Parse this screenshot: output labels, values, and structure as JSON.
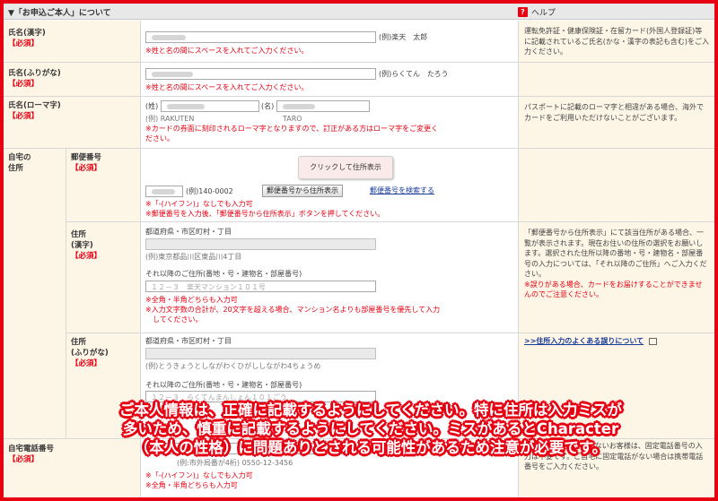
{
  "section": {
    "title": "▼「お申込ご本人」について",
    "help_label": "ヘルプ",
    "help_icon": "question-icon"
  },
  "required": "【必須】",
  "name_kanji": {
    "label": "氏名(漢字)",
    "example": "(例)楽天　太郎",
    "note": "※姓と名の間にスペースを入れてご入力ください。",
    "help": "運転免許証・健康保険証・在留カード(外国人登録証)等に記載されているご氏名(かな・漢字の表記も含む)をご入力ください。"
  },
  "name_kana": {
    "label": "氏名(ふりがな)",
    "example": "(例)らくてん　たろう",
    "note": "※姓と名の間にスペースを入れてご入力ください。"
  },
  "name_roman": {
    "label": "氏名(ローマ字)",
    "sei_label": "(姓)",
    "mei_label": "(名)",
    "example_sei": "(例) RAKUTEN",
    "example_mei": "TARO",
    "note_line1": "※カードの券面に刻印されるローマ字となりますので、訂正がある方はローマ字をご変更く",
    "note_line2": "ださい。",
    "help": "パスポートに記載のローマ字と相違がある場合、海外でカードをご利用いただけないことがございます。"
  },
  "address": {
    "label_line1": "自宅の",
    "label_line2": "住所",
    "postal": {
      "label": "郵便番号",
      "tooltip": "クリックして住所表示",
      "example": "(例)140-0002",
      "button": "郵便番号から住所表示",
      "search_link": "郵便番号を検索する",
      "note1": "※「-(ハイフン)」なしでも入力可",
      "note2": "※郵便番号を入力後、「郵便番号から住所表示」ボタンを押してください。"
    },
    "kanji": {
      "label_line1": "住所",
      "label_line2": "(漢字)",
      "pref_label": "都道府県・市区町村・丁目",
      "pref_example": "(例)東京都品川区東品川4丁目",
      "rest_label": "それ以降のご住所(番地・号・建物名・部屋番号)",
      "rest_placeholder": "１２－３　楽天マンション１０１号",
      "note1": "※全角・半角どちらも入力可",
      "note2": "※入力文字数の合計が、20文字を超える場合、マンション名よりも部屋番号を優先して入力",
      "note3": "　してください。",
      "help_line1": "「郵便番号から住所表示」にて該当住所がある場合、一覧が表示されます。現在お住いの住所の選択をお願いします。選択された住所以降の番地・号・建物名・部屋番号の入力については、「それ以降のご住所」へご入力ください。",
      "help_red": "※誤りがある場合、カードをお届けすることができませんのでご注意ください。"
    },
    "kana": {
      "label_line1": "住所",
      "label_line2": "(ふりがな)",
      "pref_label": "都道府県・市区町村・丁目",
      "pref_example": "(例)とうきょうとしながわくひがししながわ4ちょうめ",
      "rest_label": "それ以降のご住所(番地・号・建物名・部屋番号)",
      "rest_placeholder": "１２－３　らくてんまんしょん１０１ごう",
      "help_link": ">>住所入力のよくある誤りについて"
    }
  },
  "phone": {
    "label": "自宅電話番号",
    "example": "(例:市外局番が4桁) 0550-12-3456",
    "note1": "※「-(ハイフン)」なしでも入力可",
    "note2": "※全角・半角どちらも入力可",
    "help": "※固定電話をお持ちでないお客様は、固定電話番号の入力は不要です。ご自宅に固定電話がない場合は携帯電話番号をご入力ください。"
  },
  "banner": {
    "line1": "ご本人情報は、正確に記載するようにしてください。特に住所は入力ミスが",
    "line2": "多いため、慎重に記載するようにしてください。ミスがあるとCharacter",
    "line3": "（本人の性格）に問題ありとされる可能性があるため注意が必要です。"
  },
  "colors": {
    "accent_red": "#e60012",
    "label_bg": "#fdf5e6",
    "link_blue": "#1a3d99"
  }
}
